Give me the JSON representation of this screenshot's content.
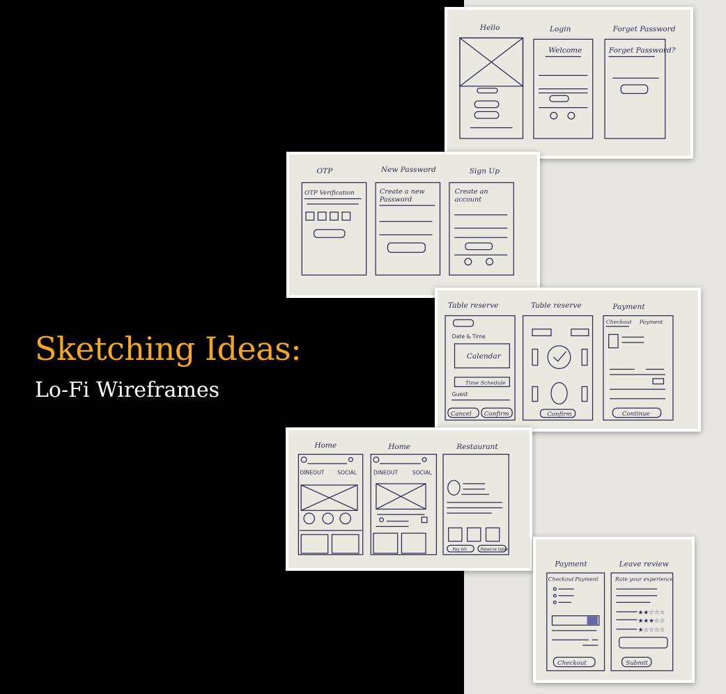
{
  "slide": {
    "title": "Sketching Ideas:",
    "subtitle": "Lo-Fi Wireframes",
    "colors": {
      "title": "#f5a623",
      "subtitle": "#ffffff",
      "left_background": "#000000",
      "right_background": "#e7e6e2",
      "ink": "#2d2a4e",
      "paper": "#e9e8e1"
    }
  },
  "sketches": {
    "photo1": {
      "screens": [
        "Hello",
        "Login",
        "Forget Password"
      ],
      "inner": {
        "login_heading": "Welcome",
        "forgot_heading": "Forget Password?"
      }
    },
    "photo2": {
      "screens": [
        "OTP",
        "New Password",
        "Sign Up"
      ],
      "inner": {
        "otp_heading": "OTP Verification",
        "newpw_line1": "Create a new",
        "newpw_line2": "Password",
        "signup_line1": "Create an",
        "signup_line2": "account"
      }
    },
    "photo3": {
      "screens": [
        "Table reserve",
        "Table reserve",
        "Payment"
      ],
      "inner": {
        "date_label": "Date & Time",
        "calendar": "Calendar",
        "time_schedule": "Time Schedule",
        "guest": "Guest",
        "cancel": "Cancel",
        "confirm": "Confirm",
        "confirm2": "Confirm",
        "checkout": "Checkout",
        "payment_tab": "Payment",
        "continue": "Continue"
      }
    },
    "photo4": {
      "screens": [
        "Home",
        "Home",
        "Restaurant"
      ],
      "inner": {
        "dineout": "DINEOUT",
        "social": "SOCIAL",
        "dineout2": "DINEOUT",
        "social2": "SOCIAL",
        "pay_bill": "Pay bill",
        "reserve_table": "Reserve table"
      }
    },
    "photo5": {
      "screens": [
        "Payment",
        "Leave review"
      ],
      "inner": {
        "checkout_tab": "Checkout",
        "payment_tab": "Payment",
        "rate": "Rate your experience",
        "checkout_btn": "Checkout",
        "submit_btn": "Submit"
      }
    }
  }
}
